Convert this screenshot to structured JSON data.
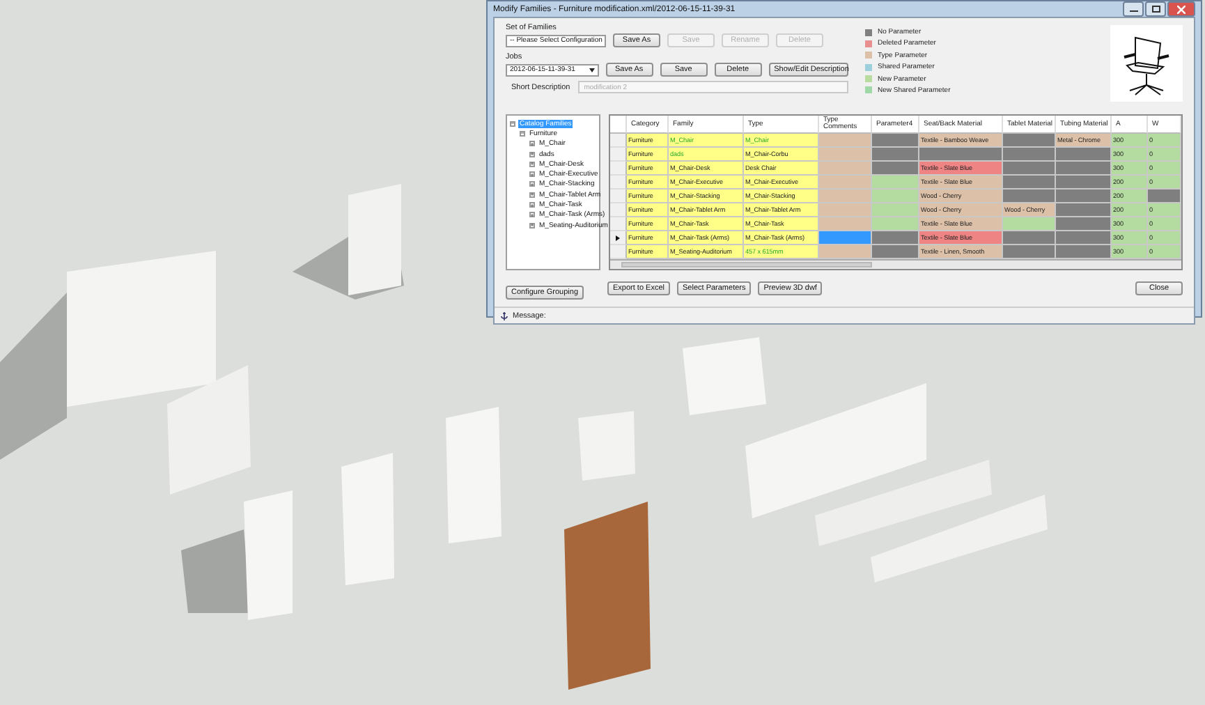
{
  "window": {
    "title": "Modify Families - Furniture modification.xml/2012-06-15-11-39-31"
  },
  "set_of_families": {
    "label": "Set of Families",
    "value": "-- Please Select Configuration",
    "buttons": [
      {
        "label": "Save As",
        "disabled": false
      },
      {
        "label": "Save",
        "disabled": true
      },
      {
        "label": "Rename",
        "disabled": true
      },
      {
        "label": "Delete",
        "disabled": true
      }
    ]
  },
  "jobs": {
    "label": "Jobs",
    "value": "2012-06-15-11-39-31",
    "buttons": [
      {
        "label": "Save As",
        "disabled": false
      },
      {
        "label": "Save",
        "disabled": false
      },
      {
        "label": "Delete",
        "disabled": false
      },
      {
        "label": "Show/Edit Description",
        "disabled": false
      }
    ]
  },
  "short_description": {
    "label": "Short Description",
    "placeholder": "modification 2"
  },
  "legend": [
    {
      "label": "No Parameter",
      "color": "#808080"
    },
    {
      "label": "Deleted Parameter",
      "color": "#e89090"
    },
    {
      "label": "Type Parameter",
      "color": "#dcc0a8"
    },
    {
      "label": "Shared Parameter",
      "color": "#9cd0dc"
    },
    {
      "label": "New Parameter",
      "color": "#b8dca0"
    },
    {
      "label": "New Shared Parameter",
      "color": "#a0d8a8"
    }
  ],
  "tree": [
    {
      "label": "Catalog Families",
      "selected": true,
      "expanded": true,
      "children": [
        {
          "label": "Furniture",
          "selected": false,
          "expanded": true,
          "children": [
            {
              "label": "M_Chair",
              "selected": false,
              "expanded": false
            },
            {
              "label": "dads",
              "selected": false,
              "expanded": false
            },
            {
              "label": "M_Chair-Desk",
              "selected": false,
              "expanded": false
            },
            {
              "label": "M_Chair-Executive",
              "selected": false,
              "expanded": false
            },
            {
              "label": "M_Chair-Stacking",
              "selected": false,
              "expanded": false
            },
            {
              "label": "M_Chair-Tablet Arm",
              "selected": false,
              "expanded": false
            },
            {
              "label": "M_Chair-Task",
              "selected": false,
              "expanded": false
            },
            {
              "label": "M_Chair-Task (Arms)",
              "selected": false,
              "expanded": false
            },
            {
              "label": "M_Seating-Auditorium",
              "selected": false,
              "expanded": false
            }
          ]
        }
      ]
    }
  ],
  "tree_buttons": [
    "Configure Grouping"
  ],
  "table": {
    "columns": [
      "Category",
      "Family",
      "Type",
      "Type Comments",
      "Parameter4",
      "Seat/Back Material",
      "Tablet Material",
      "Tubing Material",
      "A",
      "W"
    ],
    "rows": [
      {
        "current": false,
        "cells": [
          {
            "text": "Furniture",
            "kind": "key"
          },
          {
            "text": "M_Chair",
            "kind": "key_new"
          },
          {
            "text": "M_Chair",
            "kind": "key_new"
          },
          {
            "kind": "type"
          },
          {
            "kind": "none"
          },
          {
            "text": "Textile - Bamboo Weave",
            "kind": "type"
          },
          {
            "kind": "none"
          },
          {
            "text": "Metal - Chrome",
            "kind": "type"
          },
          {
            "text": "300",
            "kind": "new"
          },
          {
            "text": "0",
            "kind": "new"
          }
        ]
      },
      {
        "current": false,
        "cells": [
          {
            "text": "Furniture",
            "kind": "key"
          },
          {
            "text": "dads",
            "kind": "key_new"
          },
          {
            "text": "M_Chair-Corbu",
            "kind": "key"
          },
          {
            "kind": "type"
          },
          {
            "kind": "none"
          },
          {
            "kind": "none"
          },
          {
            "kind": "none"
          },
          {
            "kind": "none"
          },
          {
            "text": "300",
            "kind": "new"
          },
          {
            "text": "0",
            "kind": "new"
          }
        ]
      },
      {
        "current": false,
        "cells": [
          {
            "text": "Furniture",
            "kind": "key"
          },
          {
            "text": "M_Chair-Desk",
            "kind": "key"
          },
          {
            "text": "Desk Chair",
            "kind": "key"
          },
          {
            "kind": "type"
          },
          {
            "kind": "none"
          },
          {
            "text": "Textile - Slate Blue",
            "kind": "deleted"
          },
          {
            "kind": "none"
          },
          {
            "kind": "none"
          },
          {
            "text": "300",
            "kind": "new"
          },
          {
            "text": "0",
            "kind": "new"
          }
        ]
      },
      {
        "current": false,
        "cells": [
          {
            "text": "Furniture",
            "kind": "key"
          },
          {
            "text": "M_Chair-Executive",
            "kind": "key"
          },
          {
            "text": "M_Chair-Executive",
            "kind": "key"
          },
          {
            "kind": "type"
          },
          {
            "kind": "new"
          },
          {
            "text": "Textile - Slate Blue",
            "kind": "type"
          },
          {
            "kind": "none"
          },
          {
            "kind": "none"
          },
          {
            "text": "200",
            "kind": "new"
          },
          {
            "text": "0",
            "kind": "new"
          }
        ]
      },
      {
        "current": false,
        "cells": [
          {
            "text": "Furniture",
            "kind": "key"
          },
          {
            "text": "M_Chair-Stacking",
            "kind": "key"
          },
          {
            "text": "M_Chair-Stacking",
            "kind": "key"
          },
          {
            "kind": "type"
          },
          {
            "kind": "new"
          },
          {
            "text": "Wood - Cherry",
            "kind": "type"
          },
          {
            "kind": "none"
          },
          {
            "kind": "none"
          },
          {
            "text": "200",
            "kind": "new"
          },
          {
            "kind": "none"
          }
        ]
      },
      {
        "current": false,
        "cells": [
          {
            "text": "Furniture",
            "kind": "key"
          },
          {
            "text": "M_Chair-Tablet Arm",
            "kind": "key"
          },
          {
            "text": "M_Chair-Tablet Arm",
            "kind": "key"
          },
          {
            "kind": "type"
          },
          {
            "kind": "new"
          },
          {
            "text": "Wood - Cherry",
            "kind": "type"
          },
          {
            "text": "Wood - Cherry",
            "kind": "type"
          },
          {
            "kind": "none"
          },
          {
            "text": "200",
            "kind": "new"
          },
          {
            "text": "0",
            "kind": "new"
          }
        ]
      },
      {
        "current": false,
        "cells": [
          {
            "text": "Furniture",
            "kind": "key"
          },
          {
            "text": "M_Chair-Task",
            "kind": "key"
          },
          {
            "text": "M_Chair-Task",
            "kind": "key"
          },
          {
            "kind": "type"
          },
          {
            "kind": "new"
          },
          {
            "text": "Textile - Slate Blue",
            "kind": "type"
          },
          {
            "kind": "new"
          },
          {
            "kind": "none"
          },
          {
            "text": "300",
            "kind": "new"
          },
          {
            "text": "0",
            "kind": "new"
          }
        ]
      },
      {
        "current": true,
        "cells": [
          {
            "text": "Furniture",
            "kind": "key"
          },
          {
            "text": "M_Chair-Task (Arms)",
            "kind": "key"
          },
          {
            "text": "M_Chair-Task (Arms)",
            "kind": "key"
          },
          {
            "kind": "selected"
          },
          {
            "kind": "none"
          },
          {
            "text": "Textile - Slate Blue",
            "kind": "deleted"
          },
          {
            "kind": "none"
          },
          {
            "kind": "none"
          },
          {
            "text": "300",
            "kind": "new"
          },
          {
            "text": "0",
            "kind": "new"
          }
        ]
      },
      {
        "current": false,
        "cells": [
          {
            "text": "Furniture",
            "kind": "key"
          },
          {
            "text": "M_Seating-Auditorium",
            "kind": "key"
          },
          {
            "text": "457 x 615mm",
            "kind": "key_new"
          },
          {
            "kind": "type"
          },
          {
            "kind": "none"
          },
          {
            "text": "Textile - Linen, Smooth",
            "kind": "type"
          },
          {
            "kind": "none"
          },
          {
            "kind": "none"
          },
          {
            "text": "300",
            "kind": "new"
          },
          {
            "text": "0",
            "kind": "new"
          }
        ]
      }
    ]
  },
  "table_buttons": [
    "Export to Excel",
    "Select Parameters",
    "Preview 3D dwf"
  ],
  "close_button": "Close",
  "message": {
    "label": "Message:"
  }
}
